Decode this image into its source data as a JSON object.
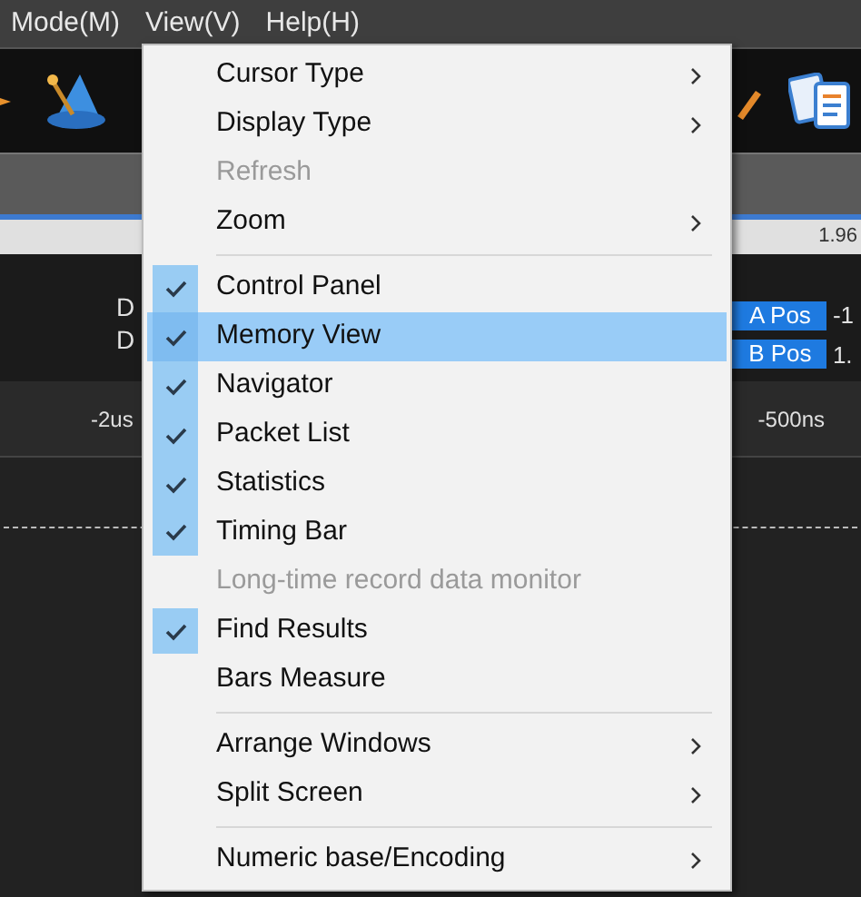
{
  "menubar": [
    {
      "label": "Mode(M)"
    },
    {
      "label": "View(V)"
    },
    {
      "label": "Help(H)"
    }
  ],
  "strip": {
    "value": "1.96"
  },
  "cursor_labels": [
    "D",
    "D"
  ],
  "markers": [
    {
      "label": "A Pos",
      "value": "-1"
    },
    {
      "label": "B Pos",
      "value": "1."
    }
  ],
  "ruler": {
    "ticks": [
      "-2us",
      "-500ns"
    ]
  },
  "menu": [
    {
      "kind": "item",
      "label": "Cursor Type",
      "submenu": true,
      "checked": false,
      "disabled": false,
      "selected": false
    },
    {
      "kind": "item",
      "label": "Display Type",
      "submenu": true,
      "checked": false,
      "disabled": false,
      "selected": false
    },
    {
      "kind": "item",
      "label": "Refresh",
      "submenu": false,
      "checked": false,
      "disabled": true,
      "selected": false
    },
    {
      "kind": "item",
      "label": "Zoom",
      "submenu": true,
      "checked": false,
      "disabled": false,
      "selected": false
    },
    {
      "kind": "separator"
    },
    {
      "kind": "item",
      "label": "Control Panel",
      "submenu": false,
      "checked": true,
      "disabled": false,
      "selected": false
    },
    {
      "kind": "item",
      "label": "Memory View",
      "submenu": false,
      "checked": true,
      "disabled": false,
      "selected": true
    },
    {
      "kind": "item",
      "label": "Navigator",
      "submenu": false,
      "checked": true,
      "disabled": false,
      "selected": false
    },
    {
      "kind": "item",
      "label": "Packet List",
      "submenu": false,
      "checked": true,
      "disabled": false,
      "selected": false
    },
    {
      "kind": "item",
      "label": "Statistics",
      "submenu": false,
      "checked": true,
      "disabled": false,
      "selected": false
    },
    {
      "kind": "item",
      "label": "Timing Bar",
      "submenu": false,
      "checked": true,
      "disabled": false,
      "selected": false
    },
    {
      "kind": "item",
      "label": "Long-time record data monitor",
      "submenu": false,
      "checked": false,
      "disabled": true,
      "selected": false
    },
    {
      "kind": "item",
      "label": "Find Results",
      "submenu": false,
      "checked": true,
      "disabled": false,
      "selected": false
    },
    {
      "kind": "item",
      "label": "Bars Measure",
      "submenu": false,
      "checked": false,
      "disabled": false,
      "selected": false
    },
    {
      "kind": "separator"
    },
    {
      "kind": "item",
      "label": "Arrange Windows",
      "submenu": true,
      "checked": false,
      "disabled": false,
      "selected": false
    },
    {
      "kind": "item",
      "label": "Split Screen",
      "submenu": true,
      "checked": false,
      "disabled": false,
      "selected": false
    },
    {
      "kind": "separator"
    },
    {
      "kind": "item",
      "label": "Numeric base/Encoding",
      "submenu": true,
      "checked": false,
      "disabled": false,
      "selected": false
    }
  ]
}
